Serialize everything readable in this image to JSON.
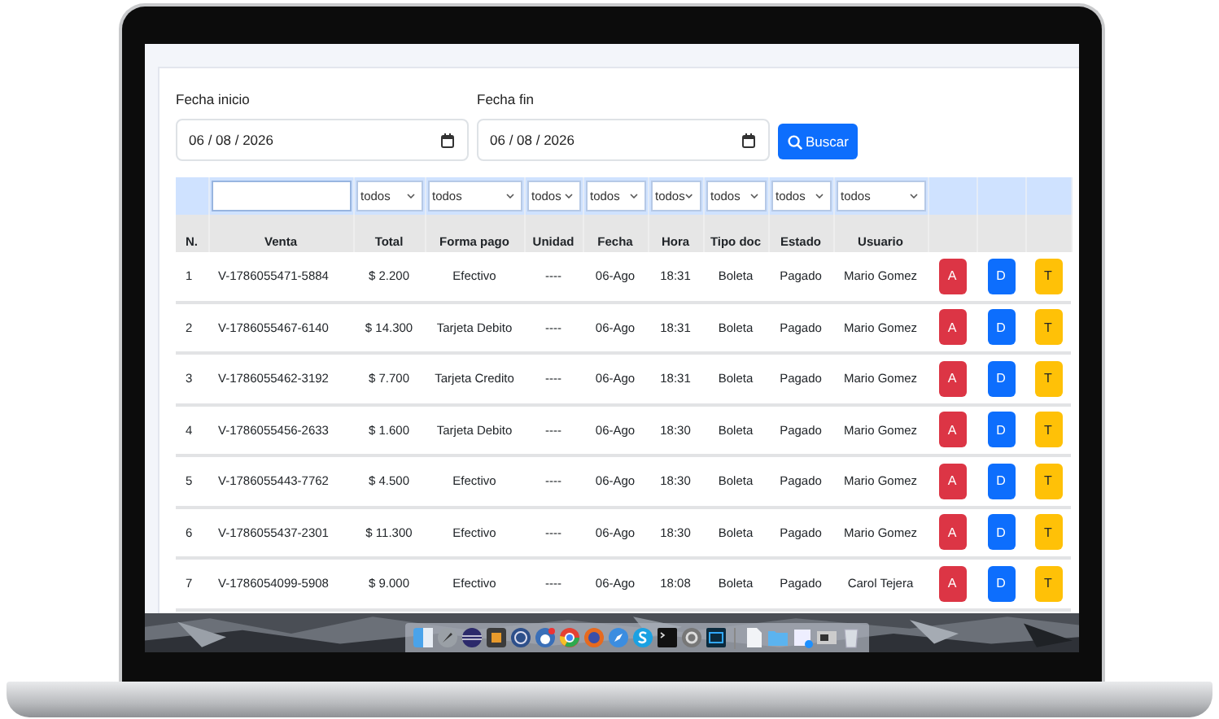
{
  "date_filters": [
    {
      "label": "Fecha inicio",
      "value": "06 / 08 / 2026"
    },
    {
      "label": "Fecha fin",
      "value": "06 / 08 / 2026"
    }
  ],
  "search_button": {
    "label": "Buscar"
  },
  "column_filters": [
    {
      "kind": "input"
    },
    {
      "kind": "select",
      "value": "todos"
    },
    {
      "kind": "select",
      "value": "todos"
    },
    {
      "kind": "select",
      "value": "todos"
    },
    {
      "kind": "select",
      "value": "todos"
    },
    {
      "kind": "select",
      "value": "todos"
    },
    {
      "kind": "select",
      "value": "todos"
    },
    {
      "kind": "select",
      "value": "todos"
    },
    {
      "kind": "select",
      "value": "todos"
    }
  ],
  "columns": [
    "N.",
    "Venta",
    "Total",
    "Forma pago",
    "Unidad",
    "Fecha",
    "Hora",
    "Tipo doc",
    "Estado",
    "Usuario"
  ],
  "rows": [
    {
      "cells": [
        "1",
        "V-1786055471-5884",
        "$ 2.200",
        "Efectivo",
        "----",
        "06-Ago",
        "18:31",
        "Boleta",
        "Pagado",
        "Mario Gomez"
      ],
      "actions": [
        {
          "label": "A",
          "color": "#dc3545"
        },
        {
          "label": "D",
          "color": "#0d6efd"
        },
        {
          "label": "T",
          "color": "#ffc107"
        }
      ]
    },
    {
      "cells": [
        "2",
        "V-1786055467-6140",
        "$ 14.300",
        "Tarjeta Debito",
        "----",
        "06-Ago",
        "18:31",
        "Boleta",
        "Pagado",
        "Mario Gomez"
      ],
      "actions": [
        {
          "label": "A",
          "color": "#dc3545"
        },
        {
          "label": "D",
          "color": "#0d6efd"
        },
        {
          "label": "T",
          "color": "#ffc107"
        }
      ]
    },
    {
      "cells": [
        "3",
        "V-1786055462-3192",
        "$ 7.700",
        "Tarjeta Credito",
        "----",
        "06-Ago",
        "18:31",
        "Boleta",
        "Pagado",
        "Mario Gomez"
      ],
      "actions": [
        {
          "label": "A",
          "color": "#dc3545"
        },
        {
          "label": "D",
          "color": "#0d6efd"
        },
        {
          "label": "T",
          "color": "#ffc107"
        }
      ]
    },
    {
      "cells": [
        "4",
        "V-1786055456-2633",
        "$ 1.600",
        "Tarjeta Debito",
        "----",
        "06-Ago",
        "18:30",
        "Boleta",
        "Pagado",
        "Mario Gomez"
      ],
      "actions": [
        {
          "label": "A",
          "color": "#dc3545"
        },
        {
          "label": "D",
          "color": "#0d6efd"
        },
        {
          "label": "T",
          "color": "#ffc107"
        }
      ]
    },
    {
      "cells": [
        "5",
        "V-1786055443-7762",
        "$ 4.500",
        "Efectivo",
        "----",
        "06-Ago",
        "18:30",
        "Boleta",
        "Pagado",
        "Mario Gomez"
      ],
      "actions": [
        {
          "label": "A",
          "color": "#dc3545"
        },
        {
          "label": "D",
          "color": "#0d6efd"
        },
        {
          "label": "T",
          "color": "#ffc107"
        }
      ]
    },
    {
      "cells": [
        "6",
        "V-1786055437-2301",
        "$ 11.300",
        "Efectivo",
        "----",
        "06-Ago",
        "18:30",
        "Boleta",
        "Pagado",
        "Mario Gomez"
      ],
      "actions": [
        {
          "label": "A",
          "color": "#dc3545"
        },
        {
          "label": "D",
          "color": "#0d6efd"
        },
        {
          "label": "T",
          "color": "#ffc107"
        }
      ]
    },
    {
      "cells": [
        "7",
        "V-1786054099-5908",
        "$ 9.000",
        "Efectivo",
        "----",
        "06-Ago",
        "18:08",
        "Boleta",
        "Pagado",
        "Carol Tejera"
      ],
      "actions": [
        {
          "label": "A",
          "color": "#dc3545"
        },
        {
          "label": "D",
          "color": "#0d6efd"
        },
        {
          "label": "T",
          "color": "#ffc107"
        }
      ]
    }
  ]
}
